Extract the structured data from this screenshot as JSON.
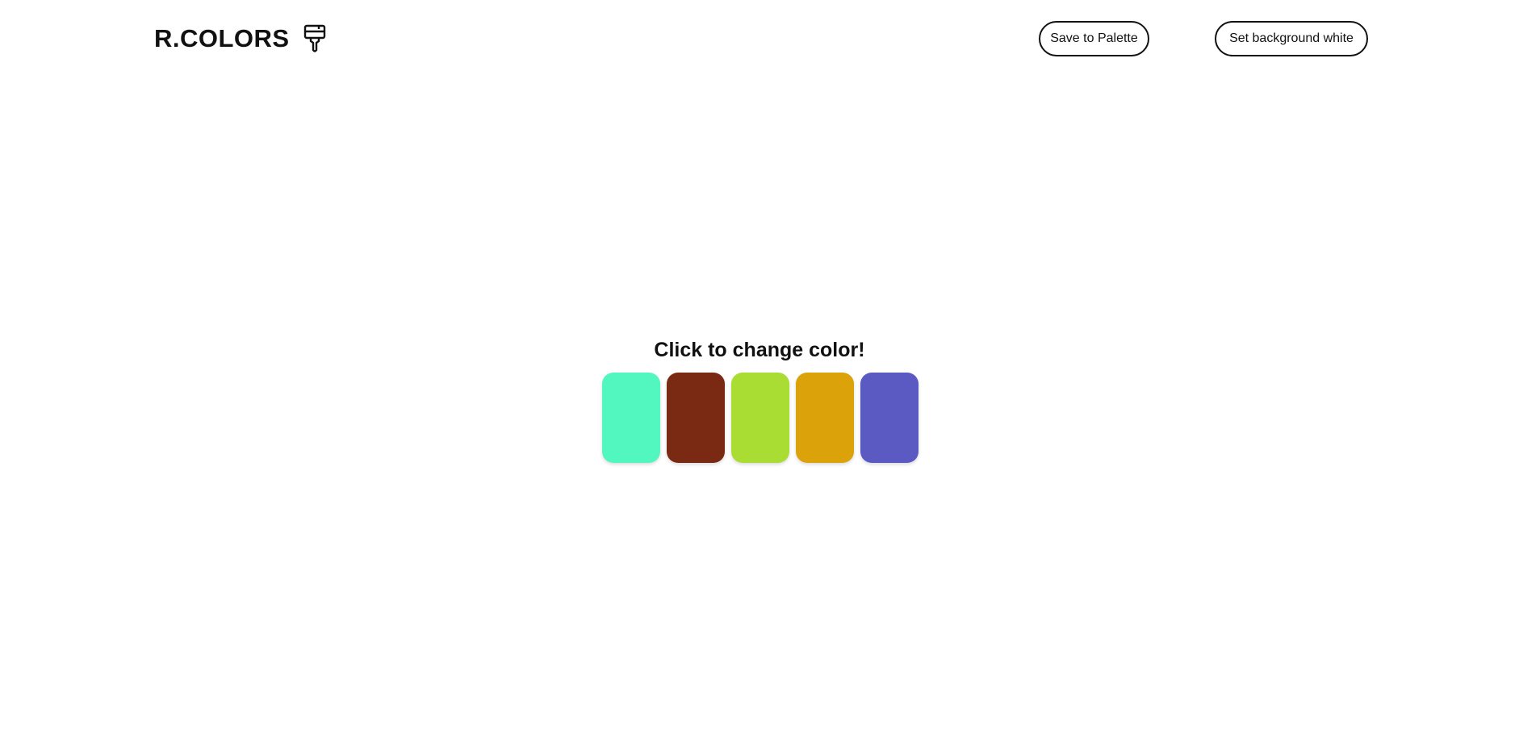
{
  "header": {
    "brand_title": "R.COLORS",
    "brand_icon": "paint-brush-icon",
    "save_button_label": "Save to Palette",
    "background_button_label": "Set background white"
  },
  "main": {
    "headline": "Click to change color!",
    "swatches": [
      {
        "color": "#52f7c0"
      },
      {
        "color": "#7a2a12"
      },
      {
        "color": "#aadd33"
      },
      {
        "color": "#dba20a"
      },
      {
        "color": "#5b59c2"
      }
    ]
  }
}
